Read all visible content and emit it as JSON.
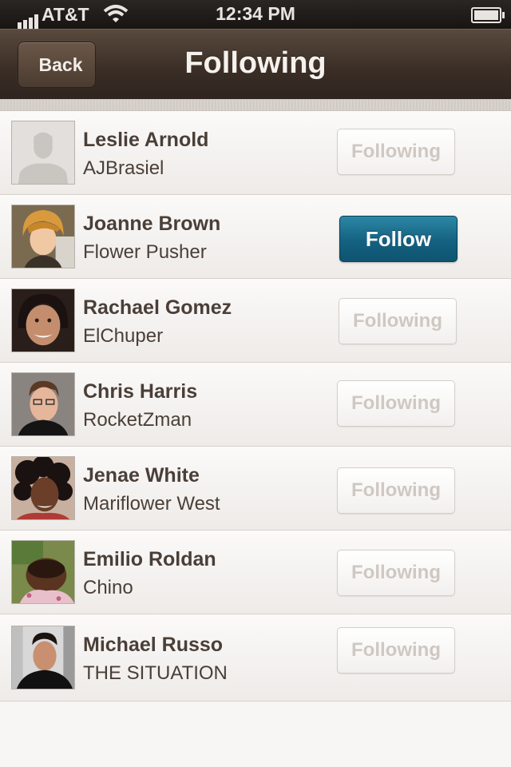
{
  "status_bar": {
    "carrier": "AT&T",
    "time": "12:34 PM"
  },
  "nav": {
    "back_label": "Back",
    "title": "Following"
  },
  "users": [
    {
      "name": "Leslie Arnold",
      "handle": "AJBrasiel",
      "button": "Following",
      "state": "following",
      "avatar": "placeholder"
    },
    {
      "name": "Joanne Brown",
      "handle": "Flower Pusher",
      "button": "Follow",
      "state": "follow",
      "avatar": "photo"
    },
    {
      "name": "Rachael Gomez",
      "handle": "ElChuper",
      "button": "Following",
      "state": "following",
      "avatar": "photo"
    },
    {
      "name": "Chris Harris",
      "handle": "RocketZman",
      "button": "Following",
      "state": "following",
      "avatar": "photo"
    },
    {
      "name": "Jenae White",
      "handle": "Mariflower West",
      "button": "Following",
      "state": "following",
      "avatar": "photo"
    },
    {
      "name": "Emilio Roldan",
      "handle": "Chino",
      "button": "Following",
      "state": "following",
      "avatar": "photo"
    },
    {
      "name": "Michael Russo",
      "handle": "THE SITUATION",
      "button": "Following",
      "state": "following",
      "avatar": "photo"
    }
  ],
  "colors": {
    "follow_button": "#146180",
    "nav_bar": "#3a2e26",
    "text": "#4a3f38"
  }
}
